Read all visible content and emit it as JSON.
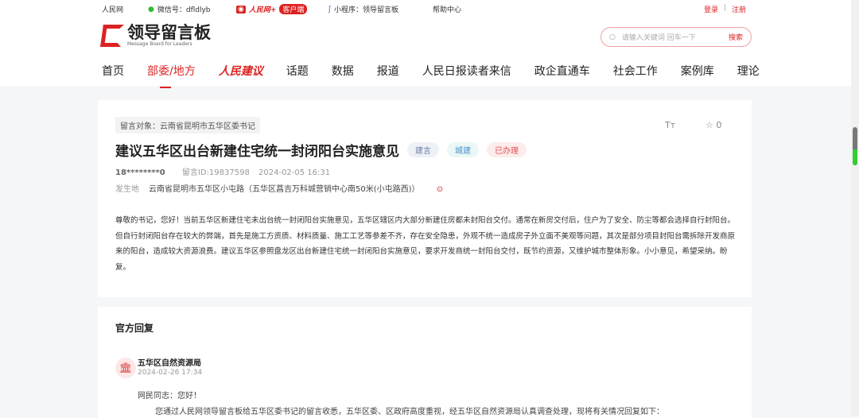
{
  "topbar": {
    "site": "人民网",
    "wechat": "微信号：dfldlyb",
    "app_brand": "人民网+",
    "app_badge": "客户端",
    "mini": "小程序：领导留言板",
    "help": "帮助中心",
    "login": "登录",
    "sep": "|",
    "register": "注册"
  },
  "logo": {
    "title": "领导留言板",
    "subtitle": "Message Board for Leaders"
  },
  "search": {
    "placeholder": "请输入关键词 回车一下",
    "button": "搜索"
  },
  "nav": [
    "首页",
    "部委/地方",
    "人民建议",
    "话题",
    "数据",
    "报道",
    "人民日报读者来信",
    "政企直通车",
    "社会工作",
    "案例库",
    "理论"
  ],
  "message": {
    "target": "留言对象：云南省昆明市五华区委书记",
    "title": "建议五华区出台新建住宅统一封闭阳台实施意见",
    "tags": [
      {
        "label": "建言",
        "bg": "#eef1f6",
        "color": "#6b7fa8"
      },
      {
        "label": "城建",
        "bg": "#eaf7f6",
        "color": "#4a90c8"
      },
      {
        "label": "已办理",
        "bg": "#fdecec",
        "color": "#e05050"
      }
    ],
    "user": "18********0",
    "id": "留言ID:19837598",
    "time": "2024-02-05 16:31",
    "place_label": "发生地",
    "place": "云南省昆明市五华区小屯路（五华区菖吉万科城营销中心南50米(小屯路西)）",
    "font_tool": "Tт",
    "stars": "☆ 0",
    "body": "尊敬的书记，您好！当前五华区新建住宅未出台统一封闭阳台实施意见，五华区辖区内大部分新建住房都未封阳台交付。通常在新房交付后，住户为了安全、防尘等都会选择自行封阳台。但自行封闭阳台存在较大的弊端，首先是施工方资质、材料质量、施工工艺等参差不齐，存在安全隐患，外观不统一造成房子外立面不美观等问题，其次是部分项目封阳台需拆除开发商原来的阳台，造成较大资源浪费。建议五华区参照盘龙区出台新建住宅统一封闭阳台实施意见，要求开发商统一封阳台交付，既节约资源，又维护城市整体形象。小小意见，希望采纳。盼复。"
  },
  "reply": {
    "heading": "官方回复",
    "org": "五华区自然资源局",
    "date": "2024-02-26 17:34",
    "greeting": "网民同志：您好！",
    "text": "您通过人民网领导留言板给五华区委书记的留言收悉，五华区委、区政府高度重视，经五华区自然资源局认真调查处理，现将有关情况回复如下："
  }
}
